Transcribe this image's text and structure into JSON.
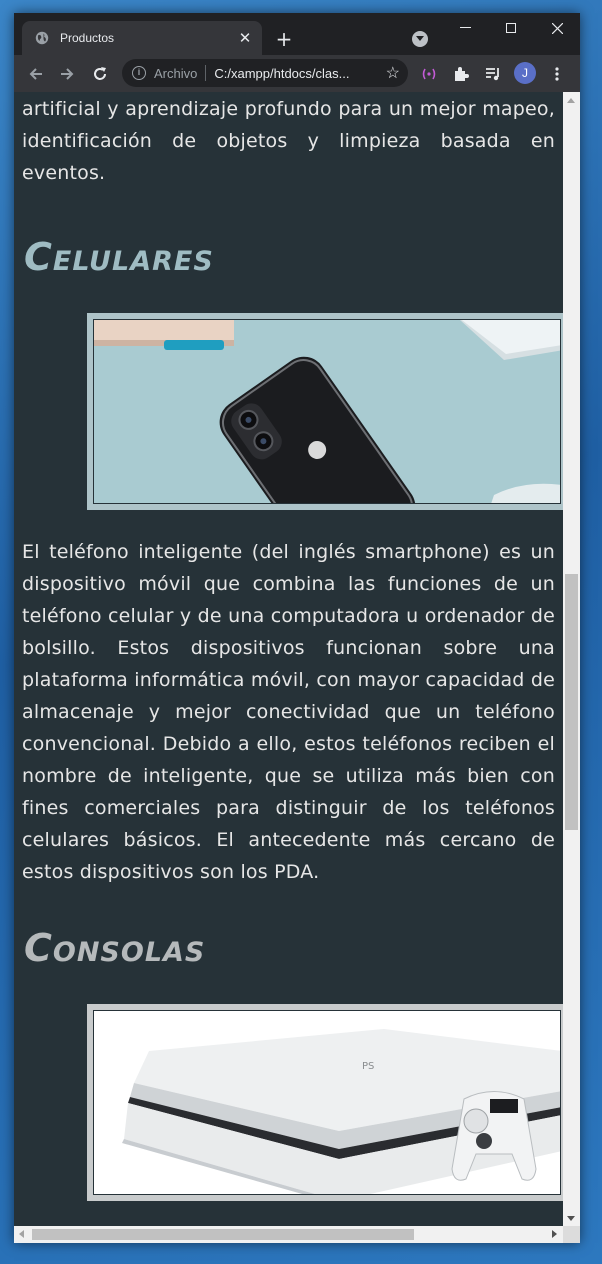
{
  "browser": {
    "tab_title": "Productos",
    "new_tab_label": "+",
    "omnibox_scheme_label": "Archivo",
    "omnibox_url": "C:/xampp/htdocs/clas...",
    "profile_initial": "J"
  },
  "page": {
    "intro_paragraph": "etc.). Los modelos más recientes utilizan inteligencia artificial y aprendizaje profundo para un mejor mapeo, identificación de objetos y limpieza basada en eventos.",
    "sections": [
      {
        "heading": "Celulares",
        "heading_color": "#9fbcc3",
        "frame_color": "#aec4c9",
        "image_alt": "black smartphone on light blue surface",
        "paragraph": "El teléfono inteligente (del inglés smartphone) es un dispositivo móvil que combina las funciones de un teléfono celular y de una computadora u ordenador de bolsillo. Estos dispositivos funcionan sobre una plataforma informática móvil, con mayor capacidad de almacenaje y mejor conectividad que un teléfono convencional. Debido a ello, estos teléfonos reciben el nombre de inteligente, que se utiliza más bien con fines comerciales para distinguir de los teléfonos celulares básicos. El antecedente más cercano de estos dispositivos son los PDA."
      },
      {
        "heading": "Consolas",
        "heading_color": "#b5b9bb",
        "frame_color": "#c8cbcc",
        "image_alt": "white game console with controller",
        "paragraph": ""
      }
    ],
    "background_color": "#263238",
    "text_color": "#e6e6e6"
  }
}
